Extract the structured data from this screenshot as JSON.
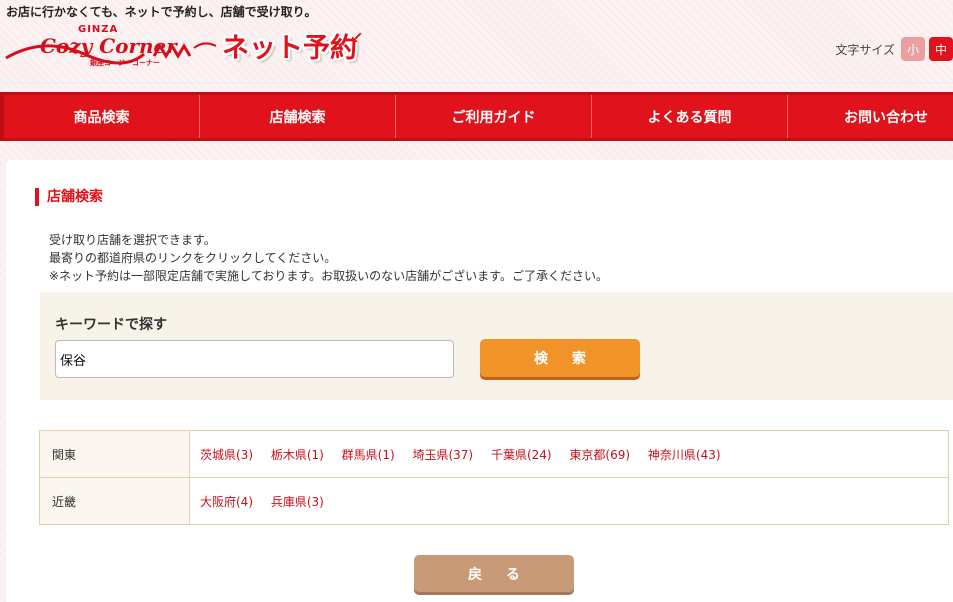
{
  "header": {
    "tagline": "お店に行かなくても、ネットで予約し、店舗で受け取り。",
    "logo": {
      "ginza": "GINZA",
      "brand": "Cozy Corner",
      "sub": "銀座コージーコーナー",
      "service": "ネット予約"
    },
    "font_size": {
      "label": "文字サイズ",
      "small": "小",
      "medium": "中"
    }
  },
  "nav": {
    "items": [
      {
        "label": "商品検索"
      },
      {
        "label": "店舗検索"
      },
      {
        "label": "ご利用ガイド"
      },
      {
        "label": "よくある質問"
      },
      {
        "label": "お問い合わせ"
      }
    ]
  },
  "main": {
    "title": "店舗検索",
    "description": [
      "受け取り店舗を選択できます。",
      "最寄りの都道府県のリンクをクリックしてください。",
      "※ネット予約は一部限定店舗で実施しております。お取扱いのない店舗がございます。ご了承ください。"
    ],
    "keyword": {
      "label": "キーワードで探す",
      "value": "保谷",
      "button": "検 索"
    },
    "regions": [
      {
        "name": "関東",
        "prefectures": [
          "茨城県(3)",
          "栃木県(1)",
          "群馬県(1)",
          "埼玉県(37)",
          "千葉県(24)",
          "東京都(69)",
          "神奈川県(43)"
        ]
      },
      {
        "name": "近畿",
        "prefectures": [
          "大阪府(4)",
          "兵庫県(3)"
        ]
      }
    ],
    "back_button": "戻 る"
  },
  "colors": {
    "brand_red": "#e0121b",
    "search_orange": "#f0942a",
    "back_tan": "#c99a78",
    "link_red": "#c8101c"
  }
}
